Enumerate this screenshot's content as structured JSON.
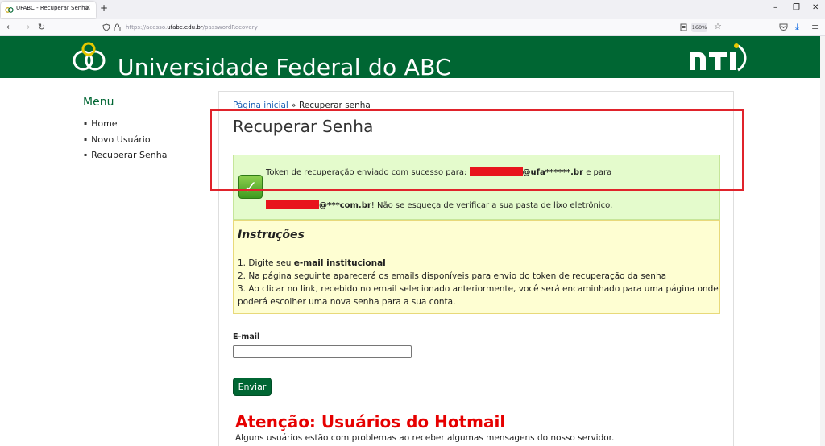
{
  "browser": {
    "tab_title": "UFABC - Recuperar Senha",
    "tab_close": "×",
    "new_tab": "+",
    "url_prefix": "https://acesso.",
    "url_host": "ufabc.edu.br",
    "url_path": "/passwordRecovery",
    "zoom": "160%",
    "win_minimize": "–",
    "win_restore": "❐",
    "win_close": "✕"
  },
  "header": {
    "title": "Universidade Federal do ABC",
    "brand_color": "#006633"
  },
  "menu": {
    "title": "Menu",
    "items": [
      "Home",
      "Novo Usuário",
      "Recuperar Senha"
    ]
  },
  "breadcrumb": {
    "home": "Página inicial",
    "separator": " » ",
    "current": "Recuperar senha"
  },
  "page_title": "Recuperar Senha",
  "success": {
    "line1_prefix": "Token de recuperação enviado com sucesso para: ",
    "line1_email_visible": "@ufa******.br",
    "line1_suffix": " e para",
    "line2_email_visible": "@***com.br",
    "line2_suffix": "! Não se esqueça de verificar a sua pasta de lixo eletrônico."
  },
  "instructions": {
    "title": "Instruções",
    "line1_prefix": "1. Digite seu ",
    "line1_bold": "e-mail institucional",
    "line2": "2. Na página seguinte aparecerá os emails disponíveis para envio do token de recuperação da senha",
    "line3": "3. Ao clicar no link, recebido no email selecionado anteriormente, você será encaminhado para uma página onde",
    "line4": "poderá escolher uma nova senha para a sua conta."
  },
  "form": {
    "email_label": "E-mail",
    "email_value": "",
    "submit_label": "Enviar"
  },
  "warning": {
    "title": "Atenção: Usuários do Hotmail",
    "text": "Alguns usuários estão com problemas ao receber algumas mensagens do nosso servidor.",
    "color": "#e60000"
  }
}
